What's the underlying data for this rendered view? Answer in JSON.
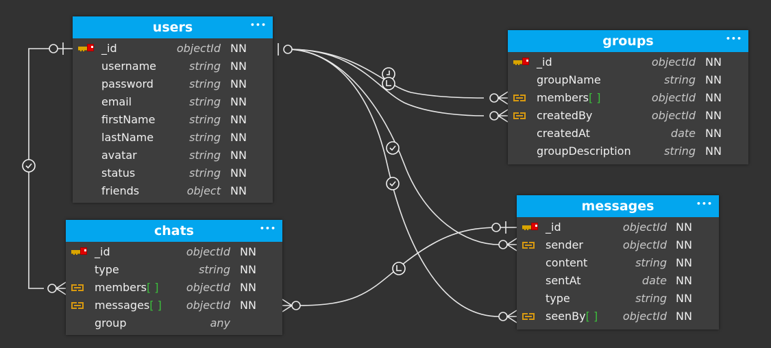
{
  "tables": {
    "users": {
      "title": "users",
      "menu": "•••",
      "columns": [
        {
          "name": "_id",
          "array": false,
          "type": "objectId",
          "nn": "NN",
          "icon": "primary-key"
        },
        {
          "name": "username",
          "array": false,
          "type": "string",
          "nn": "NN",
          "icon": ""
        },
        {
          "name": "password",
          "array": false,
          "type": "string",
          "nn": "NN",
          "icon": ""
        },
        {
          "name": "email",
          "array": false,
          "type": "string",
          "nn": "NN",
          "icon": ""
        },
        {
          "name": "firstName",
          "array": false,
          "type": "string",
          "nn": "NN",
          "icon": ""
        },
        {
          "name": "lastName",
          "array": false,
          "type": "string",
          "nn": "NN",
          "icon": ""
        },
        {
          "name": "avatar",
          "array": false,
          "type": "string",
          "nn": "NN",
          "icon": ""
        },
        {
          "name": "status",
          "array": false,
          "type": "string",
          "nn": "NN",
          "icon": ""
        },
        {
          "name": "friends",
          "array": false,
          "type": "object",
          "nn": "NN",
          "icon": ""
        }
      ]
    },
    "groups": {
      "title": "groups",
      "menu": "•••",
      "columns": [
        {
          "name": "_id",
          "array": false,
          "type": "objectId",
          "nn": "NN",
          "icon": "primary-key"
        },
        {
          "name": "groupName",
          "array": false,
          "type": "string",
          "nn": "NN",
          "icon": ""
        },
        {
          "name": "members",
          "array": true,
          "type": "objectId",
          "nn": "NN",
          "icon": "foreign-key"
        },
        {
          "name": "createdBy",
          "array": false,
          "type": "objectId",
          "nn": "NN",
          "icon": "foreign-key"
        },
        {
          "name": "createdAt",
          "array": false,
          "type": "date",
          "nn": "NN",
          "icon": ""
        },
        {
          "name": "groupDescription",
          "array": false,
          "type": "string",
          "nn": "NN",
          "icon": ""
        }
      ]
    },
    "chats": {
      "title": "chats",
      "menu": "•••",
      "columns": [
        {
          "name": "_id",
          "array": false,
          "type": "objectId",
          "nn": "NN",
          "icon": "primary-key"
        },
        {
          "name": "type",
          "array": false,
          "type": "string",
          "nn": "NN",
          "icon": ""
        },
        {
          "name": "members",
          "array": true,
          "type": "objectId",
          "nn": "NN",
          "icon": "foreign-key"
        },
        {
          "name": "messages",
          "array": true,
          "type": "objectId",
          "nn": "NN",
          "icon": "foreign-key"
        },
        {
          "name": "group",
          "array": false,
          "type": "any",
          "nn": "",
          "icon": ""
        }
      ]
    },
    "messages": {
      "title": "messages",
      "menu": "•••",
      "columns": [
        {
          "name": "_id",
          "array": false,
          "type": "objectId",
          "nn": "NN",
          "icon": "primary-key"
        },
        {
          "name": "sender",
          "array": false,
          "type": "objectId",
          "nn": "NN",
          "icon": "foreign-key"
        },
        {
          "name": "content",
          "array": false,
          "type": "string",
          "nn": "NN",
          "icon": ""
        },
        {
          "name": "sentAt",
          "array": false,
          "type": "date",
          "nn": "NN",
          "icon": ""
        },
        {
          "name": "type",
          "array": false,
          "type": "string",
          "nn": "NN",
          "icon": ""
        },
        {
          "name": "seenBy",
          "array": true,
          "type": "objectId",
          "nn": "NN",
          "icon": "foreign-key"
        }
      ]
    }
  },
  "array_marker": "[ ]",
  "relationships": [
    {
      "from": "users._id",
      "to": "chats.members",
      "from_cardinality": "one-optional",
      "to_cardinality": "many-optional"
    },
    {
      "from": "users._id",
      "to": "groups.members",
      "from_cardinality": "one-optional",
      "to_cardinality": "many-optional"
    },
    {
      "from": "users._id",
      "to": "groups.createdBy",
      "from_cardinality": "one-optional",
      "to_cardinality": "many-optional"
    },
    {
      "from": "users._id",
      "to": "messages.sender",
      "from_cardinality": "one-optional",
      "to_cardinality": "many-optional"
    },
    {
      "from": "users._id",
      "to": "messages.seenBy",
      "from_cardinality": "one-optional",
      "to_cardinality": "many-optional"
    },
    {
      "from": "messages._id",
      "to": "chats.messages",
      "from_cardinality": "one-optional",
      "to_cardinality": "many-optional"
    }
  ],
  "colors": {
    "background": "#323232",
    "table_body": "#3d3d3d",
    "header": "#03a6ee",
    "text": "#f0f0f0",
    "type_text": "#c8c8c8",
    "array_marker": "#3cbf3c",
    "fk_icon": "#d99a10",
    "pk_icon_key": "#d9a400",
    "pk_icon_head": "#e00000",
    "connector": "#e8e8e8"
  }
}
